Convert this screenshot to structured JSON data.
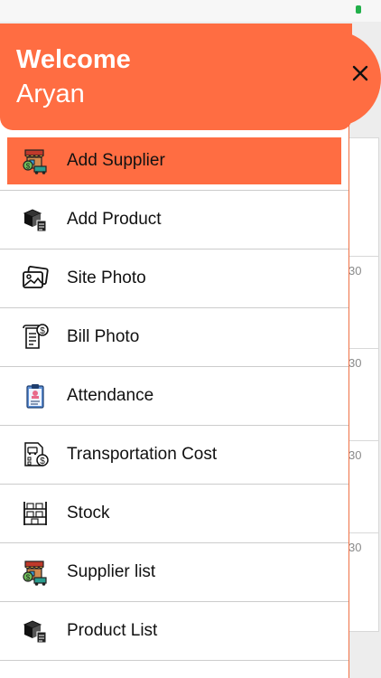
{
  "header": {
    "welcome": "Welcome",
    "user_name": "Aryan"
  },
  "menu": [
    {
      "label": "Add Supplier",
      "icon": "supplier-stall-icon",
      "active": true
    },
    {
      "label": "Add Product",
      "icon": "boxes-icon"
    },
    {
      "label": "Site Photo",
      "icon": "photo-icon"
    },
    {
      "label": "Bill Photo",
      "icon": "bill-icon"
    },
    {
      "label": "Attendance",
      "icon": "clipboard-icon"
    },
    {
      "label": "Transportation Cost",
      "icon": "transport-cost-icon"
    },
    {
      "label": "Stock",
      "icon": "shelves-icon"
    },
    {
      "label": "Supplier list",
      "icon": "supplier-stall-icon"
    },
    {
      "label": "Product List",
      "icon": "boxes-icon"
    }
  ],
  "background": {
    "numbers": [
      "30",
      "30",
      "30",
      "30"
    ]
  },
  "colors": {
    "accent": "#ff6d42",
    "divider": "#cccccc"
  }
}
